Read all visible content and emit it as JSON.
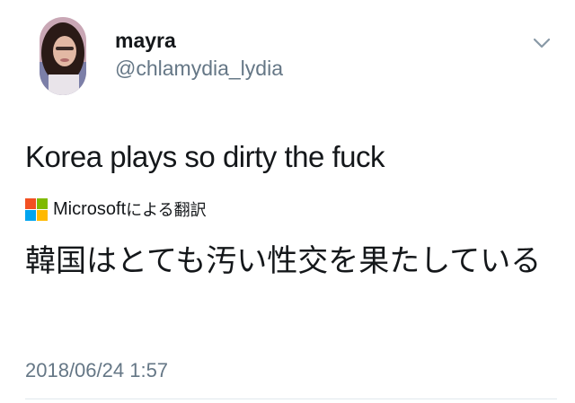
{
  "user": {
    "display_name": "mayra",
    "handle": "@chlamydia_lydia"
  },
  "tweet": {
    "text": "Korea plays so dirty the fuck",
    "translated_text": "韓国はとても汚い性交を果たしている",
    "timestamp": "2018/06/24 1:57"
  },
  "translation": {
    "provider": "Microsoft",
    "suffix": "による翻訳"
  },
  "icons": {
    "menu": "chevron-down-icon",
    "logo": "microsoft-logo-icon"
  },
  "colors": {
    "text": "#14171a",
    "secondary": "#657786",
    "ms_red": "#f25022",
    "ms_green": "#7fba00",
    "ms_blue": "#00a4ef",
    "ms_yellow": "#ffb900"
  }
}
